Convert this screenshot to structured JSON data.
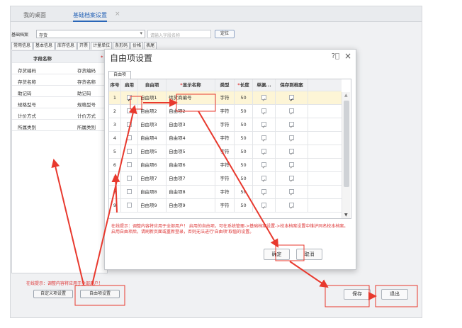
{
  "tabs": {
    "desktop": "我的桌面",
    "archive": "基础档案设置",
    "close": "×"
  },
  "filter": {
    "label": "基础档案",
    "value": "存货",
    "search_placeholder": "请输入字段名称",
    "locate_label": "定位"
  },
  "subtabs": [
    "常用信息",
    "基本信息",
    "库存信息",
    "开票",
    "计量单位",
    "条形码",
    "价格",
    "表尾"
  ],
  "left_table": {
    "header": {
      "field_name": "字段名称",
      "col2": "*"
    },
    "rows": [
      {
        "name": "存货编码",
        "value": "存货编码"
      },
      {
        "name": "存货名称",
        "value": "存货名称"
      },
      {
        "name": "助记码",
        "value": "助记码"
      },
      {
        "name": "规格型号",
        "value": "规格型号"
      },
      {
        "name": "计价方式",
        "value": "计价方式"
      },
      {
        "name": "所属类别",
        "value": "所属类别"
      }
    ]
  },
  "bottom": {
    "note": "在线提示：调整内容将应用于全部用户！",
    "custom_btn": "自定义项设置",
    "free_btn": "自由项设置",
    "save_btn": "保存",
    "exit_btn": "退出"
  },
  "dialog": {
    "title": "自由项设置",
    "help_icon": "help-circle-icon",
    "close": "×",
    "tab": "自由项",
    "columns": {
      "no": "序号",
      "enabled": "启用",
      "item": "自由项",
      "display_req": "*",
      "display": "显示名称",
      "type": "类型",
      "length_req": "*",
      "length": "长度",
      "single": "单据...",
      "save_archive": "保存到档案"
    },
    "rows": [
      {
        "no": "1",
        "enabled": true,
        "item": "自由项1",
        "display": "供货商编号",
        "type": "字符",
        "length": "50",
        "single": true,
        "save": true
      },
      {
        "no": "2",
        "enabled": false,
        "item": "自由项2",
        "display": "自由项2",
        "type": "字符",
        "length": "50",
        "single": true,
        "save": true
      },
      {
        "no": "3",
        "enabled": false,
        "item": "自由项3",
        "display": "自由项3",
        "type": "字符",
        "length": "50",
        "single": true,
        "save": true
      },
      {
        "no": "4",
        "enabled": false,
        "item": "自由项4",
        "display": "自由项4",
        "type": "字符",
        "length": "50",
        "single": true,
        "save": true
      },
      {
        "no": "5",
        "enabled": false,
        "item": "自由项5",
        "display": "自由项5",
        "type": "字符",
        "length": "50",
        "single": true,
        "save": true
      },
      {
        "no": "6",
        "enabled": false,
        "item": "自由项6",
        "display": "自由项6",
        "type": "字符",
        "length": "50",
        "single": true,
        "save": true
      },
      {
        "no": "7",
        "enabled": false,
        "item": "自由项7",
        "display": "自由项7",
        "type": "字符",
        "length": "50",
        "single": true,
        "save": true
      },
      {
        "no": "8",
        "enabled": false,
        "item": "自由项8",
        "display": "自由项8",
        "type": "字符",
        "length": "50",
        "single": true,
        "save": true
      },
      {
        "no": "9",
        "enabled": false,
        "item": "自由项9",
        "display": "自由项9",
        "type": "字符",
        "length": "50",
        "single": true,
        "save": true
      }
    ],
    "note_line1": "在线提示：调整内容将应用于全部用户！ 启用的自由项，可在系统管理->基础档案设置->校本档案设置中维护同名校本档案。",
    "note_line2": "启用自由项后，请刷新页面或重新登录，否则无法进行'自由项'取值的设置。",
    "ok_btn": "确定",
    "cancel_btn": "取消"
  },
  "colors": {
    "annotation": "#e8392e",
    "accent": "#2a66b8",
    "selected_row": "#fdf5d6"
  }
}
